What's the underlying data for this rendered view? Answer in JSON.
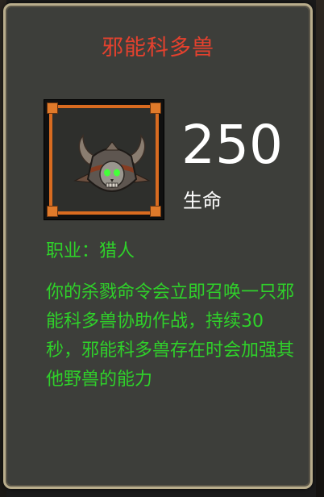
{
  "card": {
    "title": "邪能科多兽",
    "stat": {
      "value": "250",
      "label": "生命"
    },
    "class_label": "职业：",
    "class_value": "猎人",
    "description": "你的杀戮命令会立即召唤一只邪能科多兽协助作战，持续30秒，邪能科多兽存在时会加强其他野兽的能力",
    "portrait_icon": "demonic-helm-icon"
  },
  "colors": {
    "title": "#e4412e",
    "text_green": "#2fd12a",
    "frame_orange": "#d86b20",
    "card_bg": "#3d3e3a",
    "border": "#b9ad8c"
  }
}
